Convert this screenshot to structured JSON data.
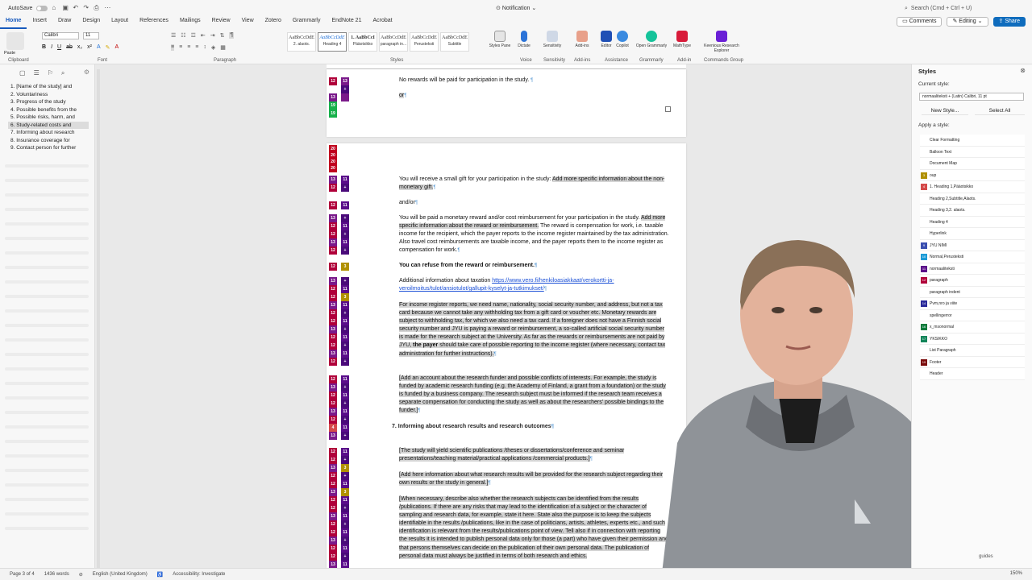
{
  "titlebar": {
    "autosave": "AutoSave",
    "doc_title": "Notification",
    "search_placeholder": "Search (Cmd + Ctrl + U)"
  },
  "tabs": [
    "Home",
    "Insert",
    "Draw",
    "Design",
    "Layout",
    "References",
    "Mailings",
    "Review",
    "View",
    "Zotero",
    "Grammarly",
    "EndNote 21",
    "Acrobat"
  ],
  "ribbon_right": {
    "comments": "Comments",
    "editing": "Editing",
    "share": "Share"
  },
  "ribbon": {
    "font": "Calibri",
    "size": "11",
    "paste": "Paste",
    "group_labels": [
      "Clipboard",
      "Font",
      "Paragraph",
      "Styles",
      "Voice",
      "Sensitivity",
      "Add-ins",
      "Assistance",
      "Grammarly",
      "Add-in",
      "Commands Group"
    ],
    "style_tiles": [
      {
        "sample": "AaBbCcDdE",
        "name": "2. alaots."
      },
      {
        "sample": "AaBbCcDdE",
        "name": "Heading 4"
      },
      {
        "sample": "1. AaBbCcI",
        "name": "Pääotsikko"
      },
      {
        "sample": "AaBbCcDdE",
        "name": "paragraph in..."
      },
      {
        "sample": "AaBbCcDdE",
        "name": "Perusteksti"
      },
      {
        "sample": "AaBbCcDdE",
        "name": "Subtitle"
      }
    ],
    "buttons": [
      "Styles Pane",
      "Dictate",
      "Sensitivity",
      "Add-ins",
      "Editor",
      "Copilot",
      "Open Grammarly",
      "MathType",
      "Keenious Research Explorer"
    ]
  },
  "nav": {
    "items": [
      "1. [Name of the study] and",
      "2. Voluntariness",
      "3. Progress of the study",
      "4. Possible benefits from the",
      "5. Possible risks, harm, and",
      "6. Study-related costs and",
      "7. Informing about research",
      "8. Insurance coverage for",
      "9. Contact person for further"
    ],
    "active_index": 5
  },
  "document": {
    "p_norewards": "No rewards will be paid for participation in the study.",
    "p_or": "or",
    "p_gift_a": "You will receive a small gift for your participation in the study: ",
    "p_gift_b": "Add more specific information about the non-monetary gift.",
    "p_andor": "and/or",
    "p_money_a": "You will be paid a monetary reward and/or cost reimbursement for your participation in the study. ",
    "p_money_b": "Add more specific information about the reward or reimbursement.",
    "p_money_c": " The reward is compensation for work, i.e. taxable income for the recipient, which the payer reports to the income register maintained by the tax administration. Also travel cost reimbursements are taxable income, and the payer reports them to the income register as compensation for work.",
    "p_refuse": "You can refuse from the reward or reimbursement.",
    "p_tax_a": "Additional information about taxation ",
    "p_tax_link": "https://www.vero.fi/henkiloasiakkaat/verokortti-ja-veroilmoitus/tulot/ansiotulot/gallupit-kyselyt-ja-tutkimukset/",
    "p_register_a": "For income register reports, we need name, nationality, social security number, and address, but not a tax card because we cannot take any withholding tax from a gift card or voucher etc. Monetary rewards are subject to withholding tax, for which we also need a tax card. If a foreigner does not have a Finnish social security number and JYU is paying a reward or reimbursement, a so-called artificial social security number is made for the research subject at the University. As far as the rewards or reimbursements are not paid by JYU, ",
    "p_register_b": "the payer",
    "p_register_c": " should take care of possible reporting to the income register (where necessary, contact tax administration for further instructions).",
    "p_funder": "[Add an account about the research funder and possible conflicts of interests. For example, the study is funded by academic research funding (e.g. the Academy of Finland, a grant from a foundation) or the study is funded by a business company. The research subject must be informed if the research team receives a separate compensation for conducting the study as well as about the researchers' possible bindings to the funder.]",
    "heading7": "7. Informing about research results and research outcomes",
    "p_yield": "[The study will yield scientific publications /theses or dissertations/conference and seminar presentations/teaching material/practical applications /commercial products.]",
    "p_results": "[Add here information about what research results will be provided for the research subject regarding their own results or the study in general.]",
    "p_when": "[When necessary, describe also whether the research subjects can be identified from the results /publications. If there are any risks that may lead to the identification of a subject or the character of sampling and research data, for example, state it here. State also the purpose is to keep the subjects identifiable in the results /publications, like in the case of politicians, artists, athletes, experts etc., and such identification is relevant from the results/publications point of view. Tell also if in connection with reporting the results it is intended to publish personal data only for those (a part) who have given their permission and that persons themselves can decide on the publication of their own personal data. The publication of personal data must always be justified in terms of both research and ethics."
  },
  "style_area": {
    "page1": [
      [
        "13",
        "s13"
      ],
      [
        "+",
        "plus"
      ],
      [
        "13",
        "s13"
      ],
      [
        "+",
        "plus"
      ],
      [
        "18",
        "s19"
      ]
    ]
  },
  "styles_pane": {
    "title": "Styles",
    "current_label": "Current style:",
    "current_value": "normaaliteksti + (Latin) Calibri, 11 pt",
    "new_style": "New Style...",
    "select_all": "Select All",
    "apply_label": "Apply a style:",
    "items": [
      {
        "name": "Clear Formatting",
        "chip": "",
        "color": ""
      },
      {
        "name": "Balloon Text",
        "chip": "",
        "color": ""
      },
      {
        "name": "Document Map",
        "chip": "",
        "color": ""
      },
      {
        "name": "oup",
        "chip": "3",
        "color": "#b09000"
      },
      {
        "name": "1. Heading 1,Pääotsikko",
        "chip": "4",
        "color": "#d44a4a"
      },
      {
        "name": "Heading 2,Subtitle,Alaots.",
        "chip": "",
        "color": ""
      },
      {
        "name": "Heading 3,2. alaots.",
        "chip": "",
        "color": ""
      },
      {
        "name": "Heading 4",
        "chip": "",
        "color": ""
      },
      {
        "name": "Hyperlink",
        "chip": "",
        "color": ""
      },
      {
        "name": "JYU NIMI",
        "chip": "9",
        "color": "#3b4fb0"
      },
      {
        "name": "Normal,Perusteksti",
        "chip": "10",
        "color": "#1a9ad6"
      },
      {
        "name": "normaaliteksti",
        "chip": "11",
        "color": "#5a0d8a"
      },
      {
        "name": "paragraph",
        "chip": "12",
        "color": "#b0003a"
      },
      {
        "name": "paragraph indent",
        "chip": "",
        "color": ""
      },
      {
        "name": "Pvm,nro ja viite",
        "chip": "14",
        "color": "#2a2a9a"
      },
      {
        "name": "spellingerror",
        "chip": "",
        "color": ""
      },
      {
        "name": "x_msonormal",
        "chip": "16",
        "color": "#0a7a3a"
      },
      {
        "name": "YKSIKKO",
        "chip": "17",
        "color": "#12855a"
      },
      {
        "name": "List Paragraph",
        "chip": "",
        "color": ""
      },
      {
        "name": "Footer",
        "chip": "19",
        "color": "#7a0a0a"
      },
      {
        "name": "Header",
        "chip": "",
        "color": ""
      }
    ]
  },
  "statusbar": {
    "page": "Page 3 of 4",
    "words": "1436 words",
    "language": "English (United Kingdom)",
    "accessibility": "Accessibility: Investigate",
    "focus_guides": "guides",
    "zoom": "150%"
  }
}
